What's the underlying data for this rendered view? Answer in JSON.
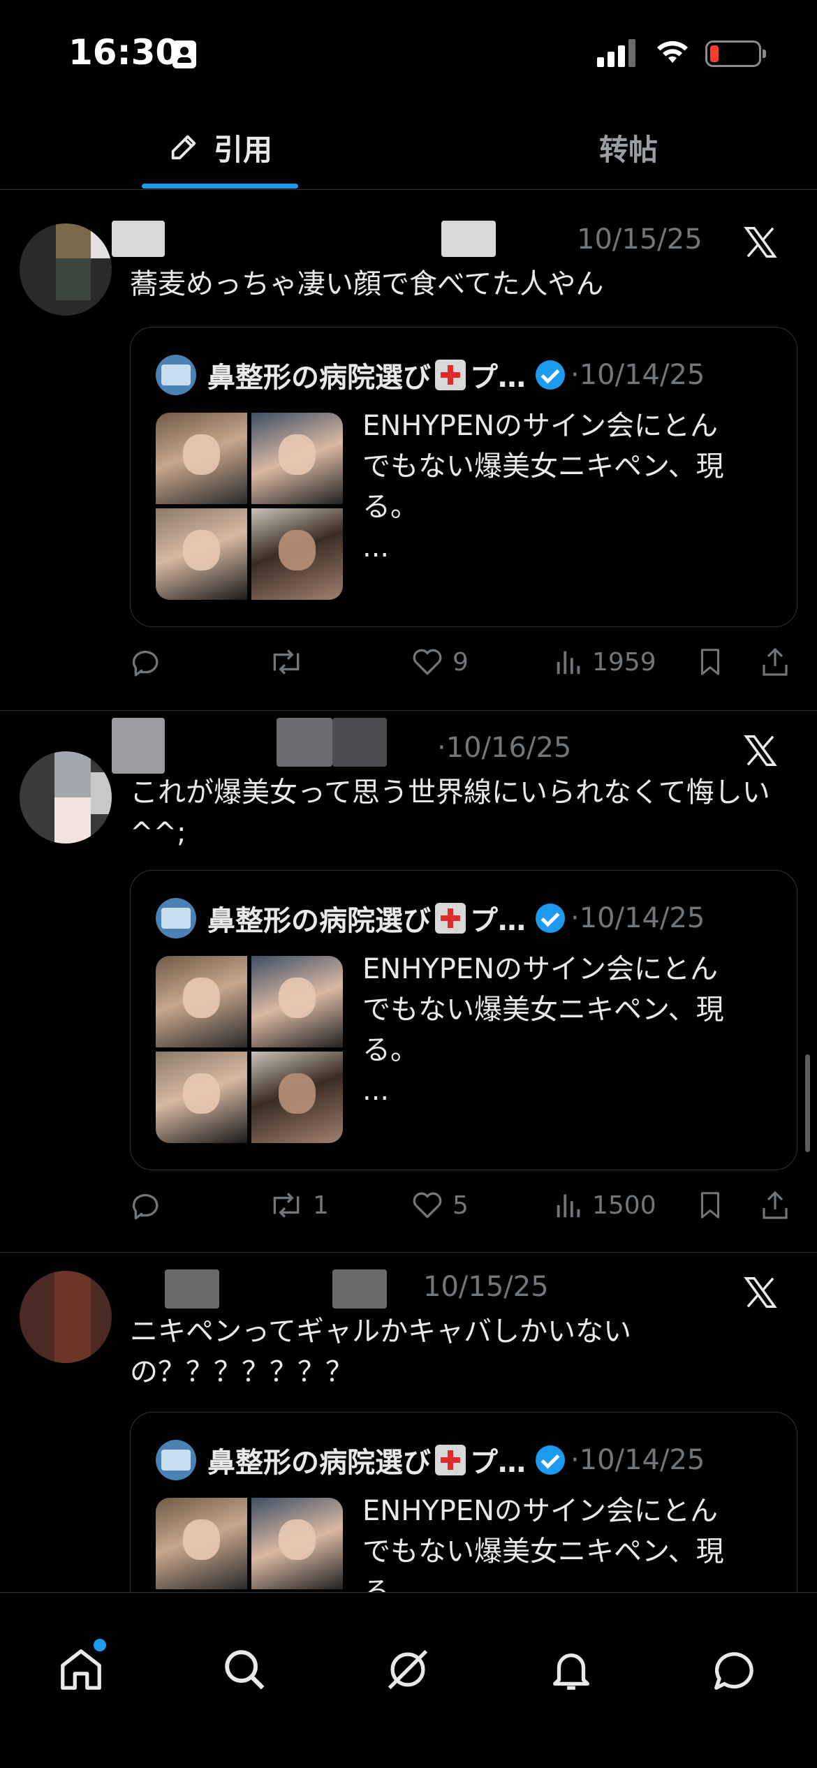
{
  "status_bar": {
    "time": "16:30"
  },
  "tabs": [
    {
      "label": "引用",
      "active": true
    },
    {
      "label": "转帖",
      "active": false
    }
  ],
  "quoted_tweet": {
    "name": "鼻整形の病院選び",
    "name_suffix": "プ…",
    "date": "·10/14/25",
    "text_line1": "ENHYPENのサイン会にとん",
    "text_line2": "でもない爆美女ニキペン、現",
    "text_line3": "る。",
    "text_more": "..."
  },
  "tweets": [
    {
      "date": "10/15/25",
      "text": "蕎麦めっちゃ凄い顔で食べてた人やん",
      "reply_count": "",
      "repost_count": "",
      "like_count": "9",
      "view_count": "1959"
    },
    {
      "date": "·10/16/25",
      "text": "これが爆美女って思う世界線にいられなくて悔しい^^;",
      "reply_count": "",
      "repost_count": "1",
      "like_count": "5",
      "view_count": "1500"
    },
    {
      "date": "10/15/25",
      "text": "ニキペンってギャルかキャバしかいないの？？？？？？？",
      "reply_count": "",
      "repost_count": "",
      "like_count": "",
      "view_count": ""
    }
  ],
  "bottom_nav": [
    "home-icon",
    "search-icon",
    "grok-icon",
    "notifications-icon",
    "messages-icon"
  ],
  "colors": {
    "accent": "#1d9bf0",
    "background": "#000000",
    "muted": "#71767b",
    "border": "#2f3336"
  }
}
